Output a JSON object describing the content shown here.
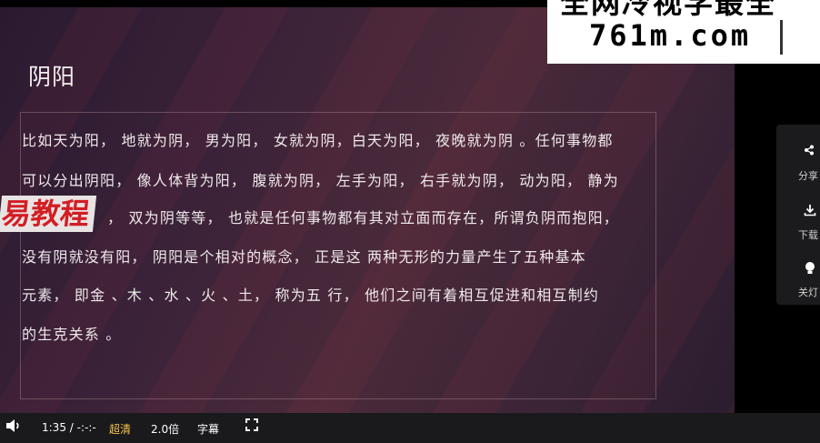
{
  "slide": {
    "title": "阴阳",
    "lines": [
      "比如天为阳， 地就为阴， 男为阳， 女就为阴，白天为阳， 夜晚就为阴 。任何事物都",
      "可以分出阴阳， 像人体背为阳， 腹就为阴， 左手为阳， 右手就为阴， 动为阳， 静为",
      "， 双为阴等等， 也就是任何事物都有其对立面而存在，所谓负阴而抱阳，",
      "没有阴就没有阳， 阴阳是个相对的概念， 正是这  两种无形的力量产生了五种基本",
      "元素， 即金 、木 、水 、火 、土， 称为五    行， 他们之间有着相互促进和相互制约",
      "的生克关系 。"
    ]
  },
  "watermark_red": "易教程",
  "logo": {
    "top_text": "全网冷视学最全",
    "main_text": "761m.com"
  },
  "side_panel": {
    "share_label": "分享",
    "download_label": "下载",
    "light_label": "关灯"
  },
  "controls": {
    "time": "1:35 / -:-:-",
    "quality": "超清",
    "speed": "2.0倍",
    "subtitle": "字幕"
  },
  "icons": {
    "volume": "speaker-icon",
    "fullscreen": "fullscreen-icon",
    "share": "share-icon",
    "download": "download-icon",
    "light": "lightbulb-icon"
  }
}
